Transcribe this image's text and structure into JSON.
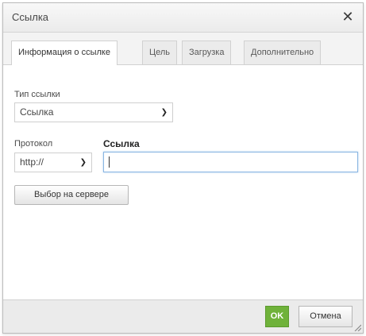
{
  "dialog": {
    "title": "Ссылка",
    "close_symbol": "✕"
  },
  "tabs": [
    {
      "label": "Информация о ссылке",
      "active": true
    },
    {
      "label": "Цель",
      "active": false
    },
    {
      "label": "Загрузка",
      "active": false
    },
    {
      "label": "Дополнительно",
      "active": false
    }
  ],
  "form": {
    "link_type_label": "Тип ссылки",
    "link_type_value": "Ссылка",
    "protocol_label": "Протокол",
    "protocol_value": "http://",
    "url_label": "Ссылка",
    "url_value": "",
    "browse_server_label": "Выбор на сервере"
  },
  "footer": {
    "ok_label": "OK",
    "cancel_label": "Отмена"
  },
  "colors": {
    "ok_button": "#6fb23a",
    "input_focus_border": "#8ab6e2"
  },
  "icons": {
    "close": "close-icon",
    "dropdown": "chevron-down-icon",
    "resize": "resize-grip-icon"
  }
}
